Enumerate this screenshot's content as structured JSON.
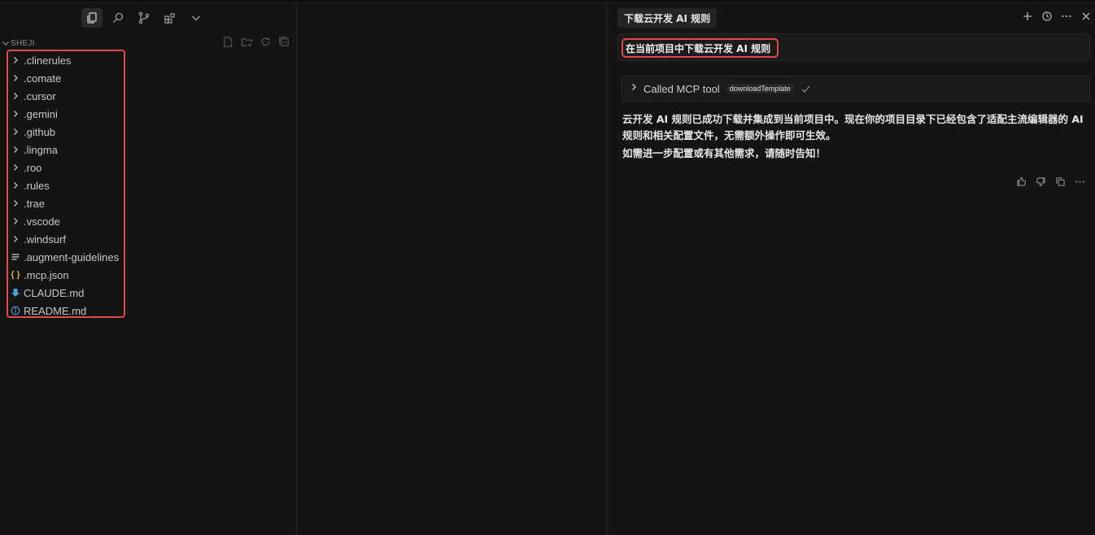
{
  "sidebar": {
    "section_title": "SHEJI",
    "files": [
      {
        "name": ".clinerules",
        "kind": "folder"
      },
      {
        "name": ".comate",
        "kind": "folder"
      },
      {
        "name": ".cursor",
        "kind": "folder"
      },
      {
        "name": ".gemini",
        "kind": "folder"
      },
      {
        "name": ".github",
        "kind": "folder"
      },
      {
        "name": ".lingma",
        "kind": "folder"
      },
      {
        "name": ".roo",
        "kind": "folder"
      },
      {
        "name": ".rules",
        "kind": "folder"
      },
      {
        "name": ".trae",
        "kind": "folder"
      },
      {
        "name": ".vscode",
        "kind": "folder"
      },
      {
        "name": ".windsurf",
        "kind": "folder"
      },
      {
        "name": ".augment-guidelines",
        "kind": "text-file"
      },
      {
        "name": ".mcp.json",
        "kind": "json-file"
      },
      {
        "name": "CLAUDE.md",
        "kind": "markdown-file"
      },
      {
        "name": "README.md",
        "kind": "info-file"
      }
    ]
  },
  "chat": {
    "tab_title": "下载云开发 AI 规则",
    "user_message": "在当前项目中下载云开发 AI 规则",
    "tool_call": {
      "label": "Called MCP tool",
      "tool_name": "downloadTemplate"
    },
    "reply": [
      "云开发 AI 规则已成功下载并集成到当前项目中。现在你的项目目录下已经包含了适配主流编辑器的 AI 规则和相关配置文件，无需额外操作即可生效。",
      "如需进一步配置或有其他需求，请随时告知！"
    ]
  },
  "colors": {
    "highlight": "#e04a4a",
    "json_icon": "#d7ba3b",
    "md_icon": "#4a9fd8",
    "info_icon": "#5aa0d8"
  }
}
